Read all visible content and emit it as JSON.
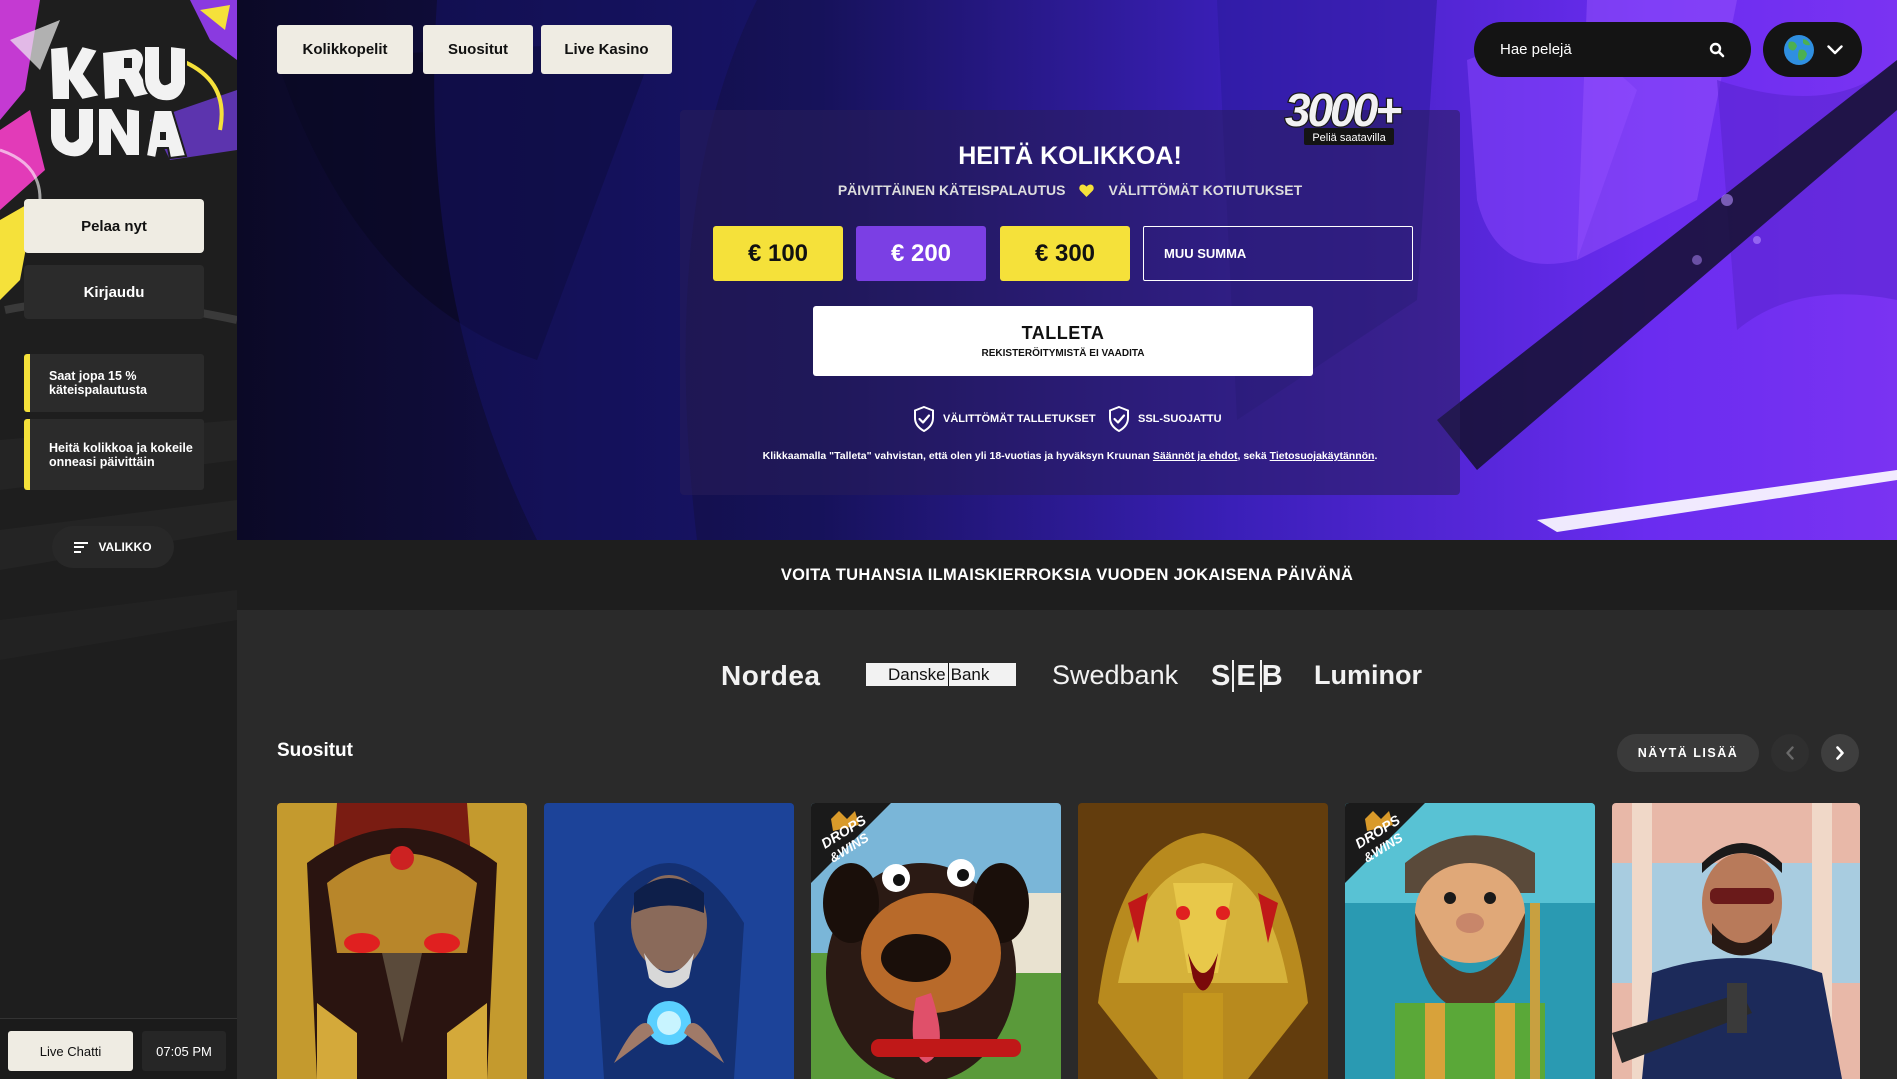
{
  "sidebar": {
    "play_label": "Pelaa nyt",
    "login_label": "Kirjaudu",
    "promos": [
      "Saat jopa 15 % käteispalautusta",
      "Heitä kolikkoa ja kokeile onneasi päivittäin"
    ],
    "menu_label": "VALIKKO",
    "live_chat_label": "Live Chatti",
    "clock": "07:05 PM"
  },
  "nav": {
    "tabs": [
      "Kolikkopelit",
      "Suositut",
      "Live Kasino"
    ],
    "search_placeholder": "Hae pelejä"
  },
  "hero": {
    "badge_number": "3000+",
    "badge_caption": "Peliä saatavilla",
    "title": "HEITÄ KOLIKKOA!",
    "sub_left": "PÄIVITTÄINEN KÄTEISPALAUTUS",
    "sub_right": "VÄLITTÖMÄT KOTIUTUKSET",
    "amounts": [
      "€ 100",
      "€ 200",
      "€ 300"
    ],
    "selected_amount": "€ 200",
    "custom_amount_placeholder": "MUU SUMMA",
    "deposit_label": "TALLETA",
    "deposit_sub": "REKISTERÖITYMISTÄ EI VAADITA",
    "trust_1": "VÄLITTÖMÄT TALLETUKSET",
    "trust_2": "SSL-SUOJATTU",
    "legal_pre": "Klikkaamalla \"Talleta\" vahvistan, että olen yli 18-vuotias ja hyväksyn Kruunan ",
    "legal_link1": "Säännöt ja ehdot",
    "legal_mid": ", sekä ",
    "legal_link2": "Tietosuojakäytännön",
    "legal_post": "."
  },
  "banner": {
    "text": "VOITA TUHANSIA ILMAISKIERROKSIA VUODEN JOKAISENA PÄIVÄNÄ"
  },
  "banks": {
    "nordea": "Nordea",
    "danske_1": "Danske",
    "danske_2": "Bank",
    "swedbank": "Swedbank",
    "seb_1": "S",
    "seb_2": "E",
    "seb_3": "B",
    "luminor": "Luminor"
  },
  "popular": {
    "title": "Suositut",
    "show_more": "NÄYTÄ LISÄÄ",
    "drops_badge_1": "DROPS",
    "drops_badge_2": "&WINS"
  },
  "colors": {
    "accent_yellow": "#f5e13a",
    "accent_purple": "#7b3fe4"
  }
}
